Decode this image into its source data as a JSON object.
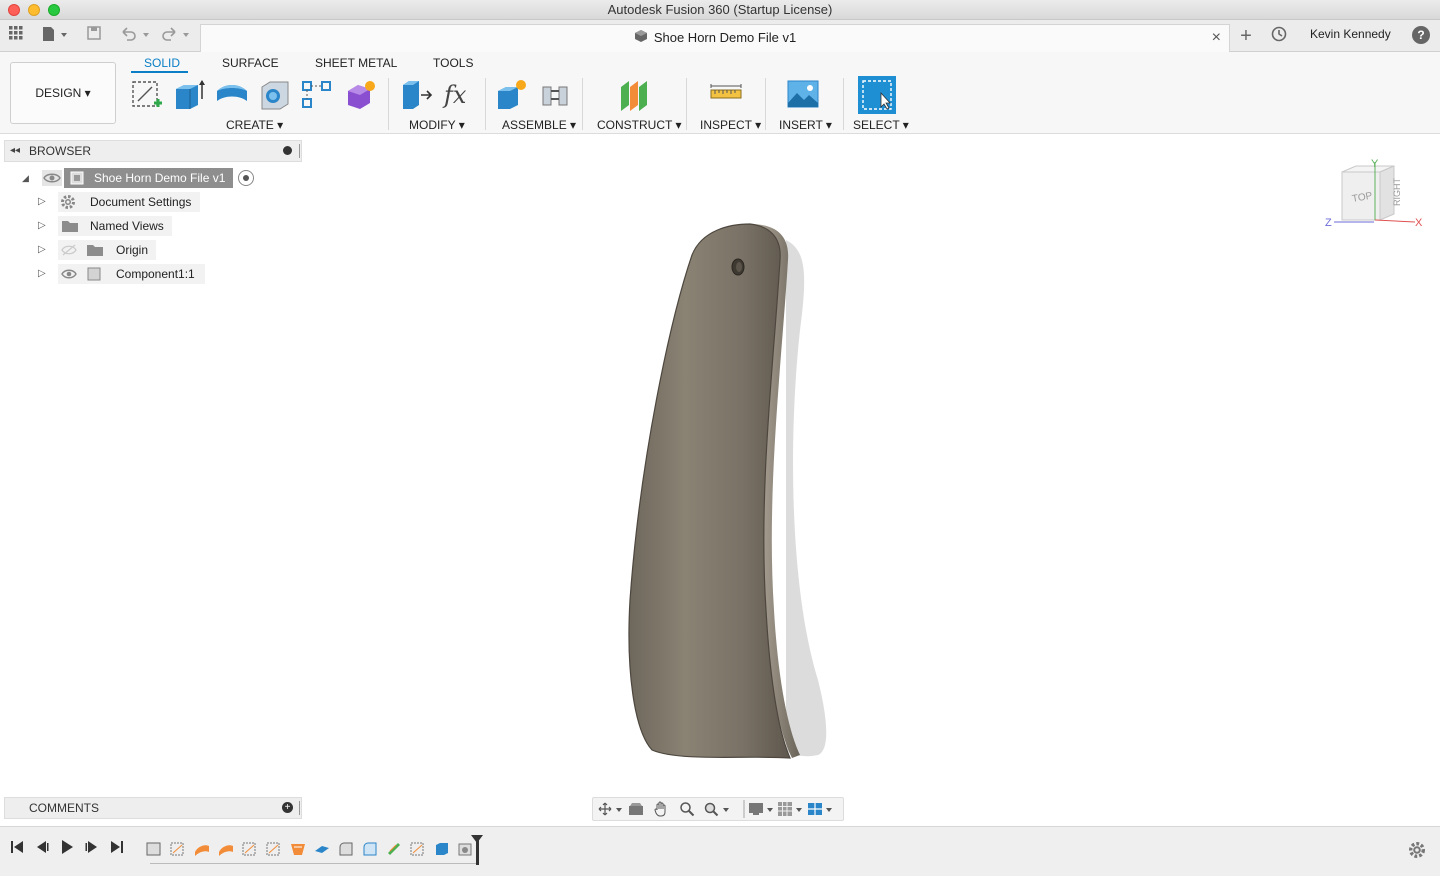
{
  "window": {
    "title": "Autodesk Fusion 360 (Startup License)"
  },
  "tabbar": {
    "document_tab": "Shoe Horn Demo File v1",
    "user": "Kevin Kennedy",
    "help": "?"
  },
  "toolbar": {
    "workspace": "DESIGN ▾",
    "tabs": [
      "SOLID",
      "SURFACE",
      "SHEET METAL",
      "TOOLS"
    ],
    "groups": [
      "CREATE ▾",
      "MODIFY ▾",
      "ASSEMBLE ▾",
      "CONSTRUCT ▾",
      "INSPECT ▾",
      "INSERT ▾",
      "SELECT ▾"
    ]
  },
  "browser": {
    "title": "BROWSER",
    "root": "Shoe Horn Demo File v1",
    "items": [
      "Document Settings",
      "Named Views",
      "Origin",
      "Component1:1"
    ]
  },
  "comments": {
    "title": "COMMENTS"
  },
  "viewcube": {
    "top": "TOP",
    "right": "RIGHT",
    "axis_x": "X",
    "axis_y": "Y",
    "axis_z": "Z"
  },
  "colors": {
    "accent": "#0a7fc6",
    "select_blue": "#1e8fd3",
    "model": "#7a7266"
  }
}
